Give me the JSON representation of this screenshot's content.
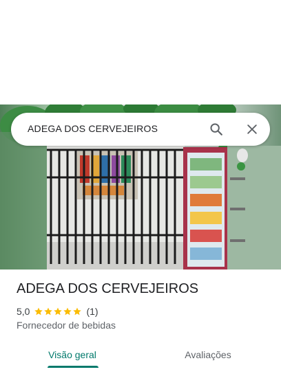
{
  "search": {
    "query": "ADEGA DOS CERVEJEIROS"
  },
  "place": {
    "name": "ADEGA DOS CERVEJEIROS",
    "rating_value": "5,0",
    "rating_stars": 5,
    "review_count": "(1)",
    "category": "Fornecedor de bebidas"
  },
  "tabs": [
    {
      "label": "Visão geral",
      "active": true
    },
    {
      "label": "Avaliações",
      "active": false
    }
  ],
  "colors": {
    "accent": "#00796b",
    "star": "#fbbc04"
  },
  "icons": {
    "search": "search-icon",
    "close": "close-icon",
    "star": "star-icon"
  }
}
